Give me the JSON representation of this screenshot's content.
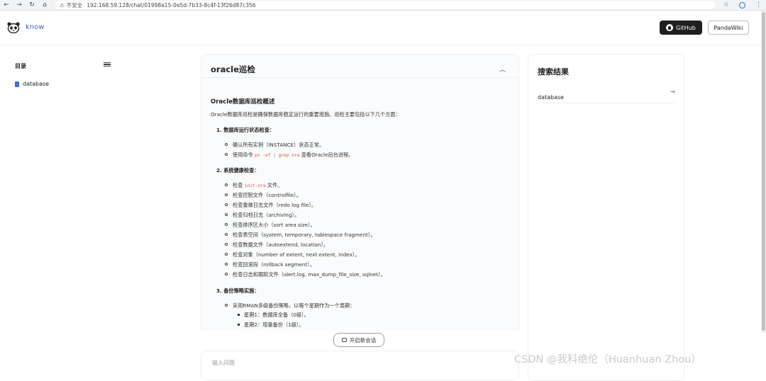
{
  "browser": {
    "nav_icons": [
      "←",
      "→",
      "↻",
      "⌂"
    ],
    "security_warning": "不安全",
    "url": "192.168.59.128/chat/01998a15-0e5d-7b33-8c4f-13f26d87c356",
    "right_icons": [
      "☆",
      "⋮"
    ]
  },
  "header": {
    "brand": "know",
    "github_label": "GitHub",
    "pandawiki_label": "PandaWiki"
  },
  "toc": {
    "title": "目录",
    "items": [
      {
        "label": "database"
      }
    ]
  },
  "answer": {
    "title": "oracle巡检",
    "heading": "Oracle数据库巡检概述",
    "intro": "Oracle数据库巡检是确保数据库稳定运行的重要措施。巡检主要包括以下几个方面：",
    "sections": [
      {
        "title": "1. 数据库运行状态检查：",
        "items": [
          {
            "text": "确认所有实例（INSTANCE）状态正常。"
          },
          {
            "pre": "使用命令",
            "code": "ps -ef | grep ora",
            "post": "查看Oracle后台进程。"
          }
        ]
      },
      {
        "title": "2. 系统健康检查：",
        "items": [
          {
            "pre": "检查",
            "code": "init.ora",
            "post": "文件。"
          },
          {
            "text": "检查控制文件（controlfile）。"
          },
          {
            "text": "检查重做日志文件（redo log file）。"
          },
          {
            "text": "检查归档日志（archiving）。"
          },
          {
            "text": "检查排序区大小（sort area size）。"
          },
          {
            "text": "检查表空间（system, temporary, tablespace fragment）。"
          },
          {
            "text": "检查数据文件（autoextend, location）。"
          },
          {
            "text": "检查对象（number of extent, next extent, index）。"
          },
          {
            "text": "检查回滚段（rollback segment）。"
          },
          {
            "text": "检查日志和跟踪文件（alert.log, max_dump_file_size, sqlnet）。"
          }
        ]
      },
      {
        "title": "3. 备份策略实施：",
        "items": [
          {
            "text": "采用RMAN多级备份策略，以每个星期作为一个周期："
          }
        ],
        "subitems": [
          {
            "text": "星期1：数据库全备（0级）。"
          },
          {
            "text": "星期2：增量备份（1级）。"
          }
        ]
      }
    ]
  },
  "new_chat_label": "开启新会话",
  "input": {
    "placeholder": "输入问题"
  },
  "search": {
    "title": "搜索结果",
    "results": [
      {
        "label": "database"
      }
    ]
  },
  "watermark": "CSDN @我科绝伦（Huanhuan Zhou）"
}
